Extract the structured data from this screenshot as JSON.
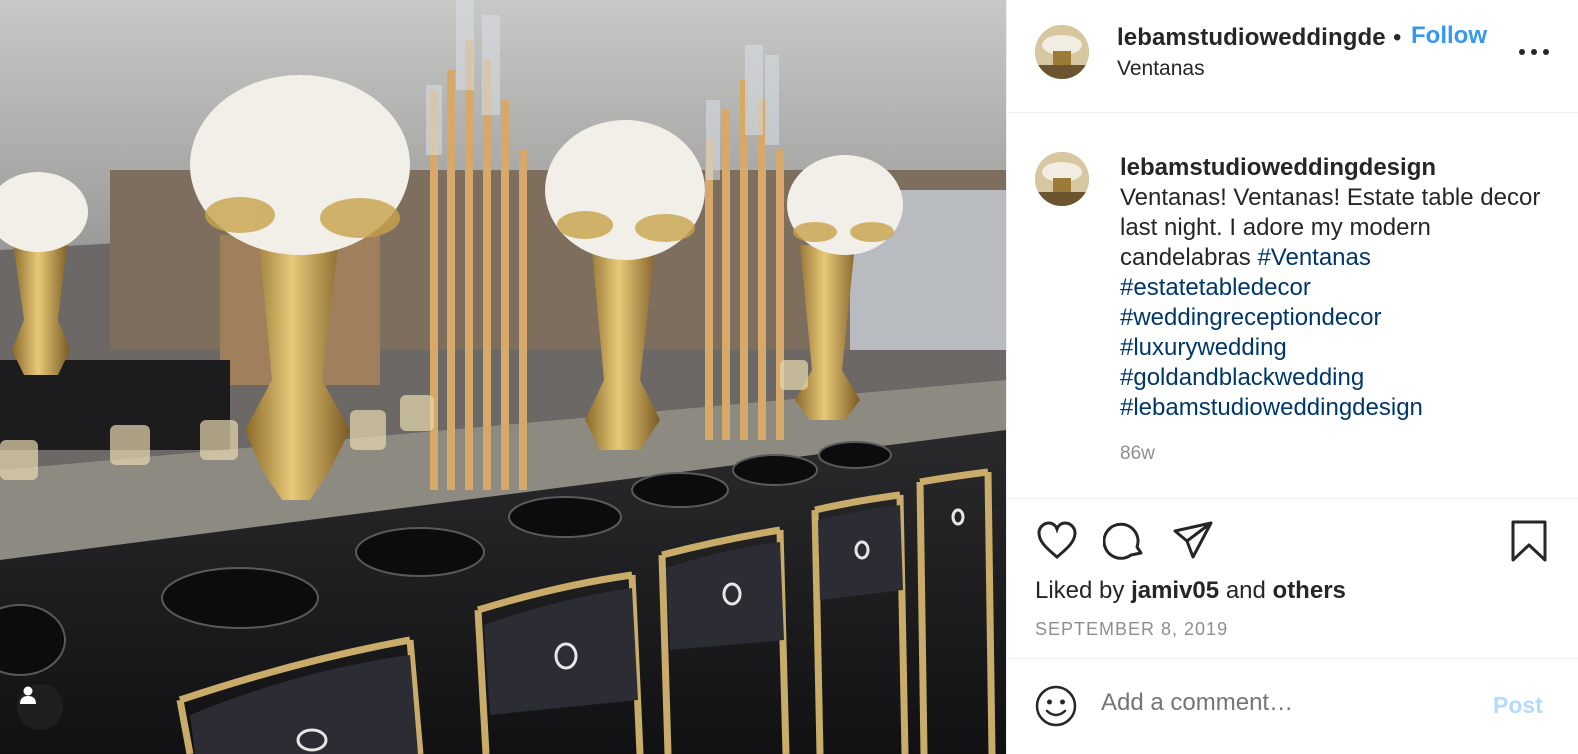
{
  "post": {
    "username": "lebamstudioweddingdesign",
    "username_truncated": "lebamstudioweddingde",
    "follow_label": "Follow",
    "separator": "•",
    "location": "Ventanas"
  },
  "caption": {
    "username": "lebamstudioweddingdesign",
    "text": "Ventanas! Ventanas! Estate table decor last night. I adore my modern candelabras",
    "inline_hashtag": "#Ventanas",
    "hashtags": [
      "#estatetabledecor",
      "#weddingreceptiondecor",
      "#luxurywedding",
      "#goldandblackwedding",
      "#lebamstudioweddingdesign"
    ],
    "time_ago": "86w"
  },
  "likes": {
    "prefix": "Liked by",
    "user": "jamiv05",
    "middle": "and",
    "others": "others"
  },
  "date": "SEPTEMBER 8, 2019",
  "comment": {
    "placeholder": "Add a comment…",
    "post_label": "Post"
  },
  "icons": {
    "like": "heart-icon",
    "comment": "comment-bubble-icon",
    "share": "paper-plane-icon",
    "save": "bookmark-icon",
    "more": "more-options-icon",
    "emoji": "emoji-smile-icon",
    "tags": "user-tag-icon"
  },
  "colors": {
    "link": "#3897f0",
    "hashtag": "#00376b",
    "muted": "#8e8e8e",
    "post_disabled": "#b3dbff"
  }
}
